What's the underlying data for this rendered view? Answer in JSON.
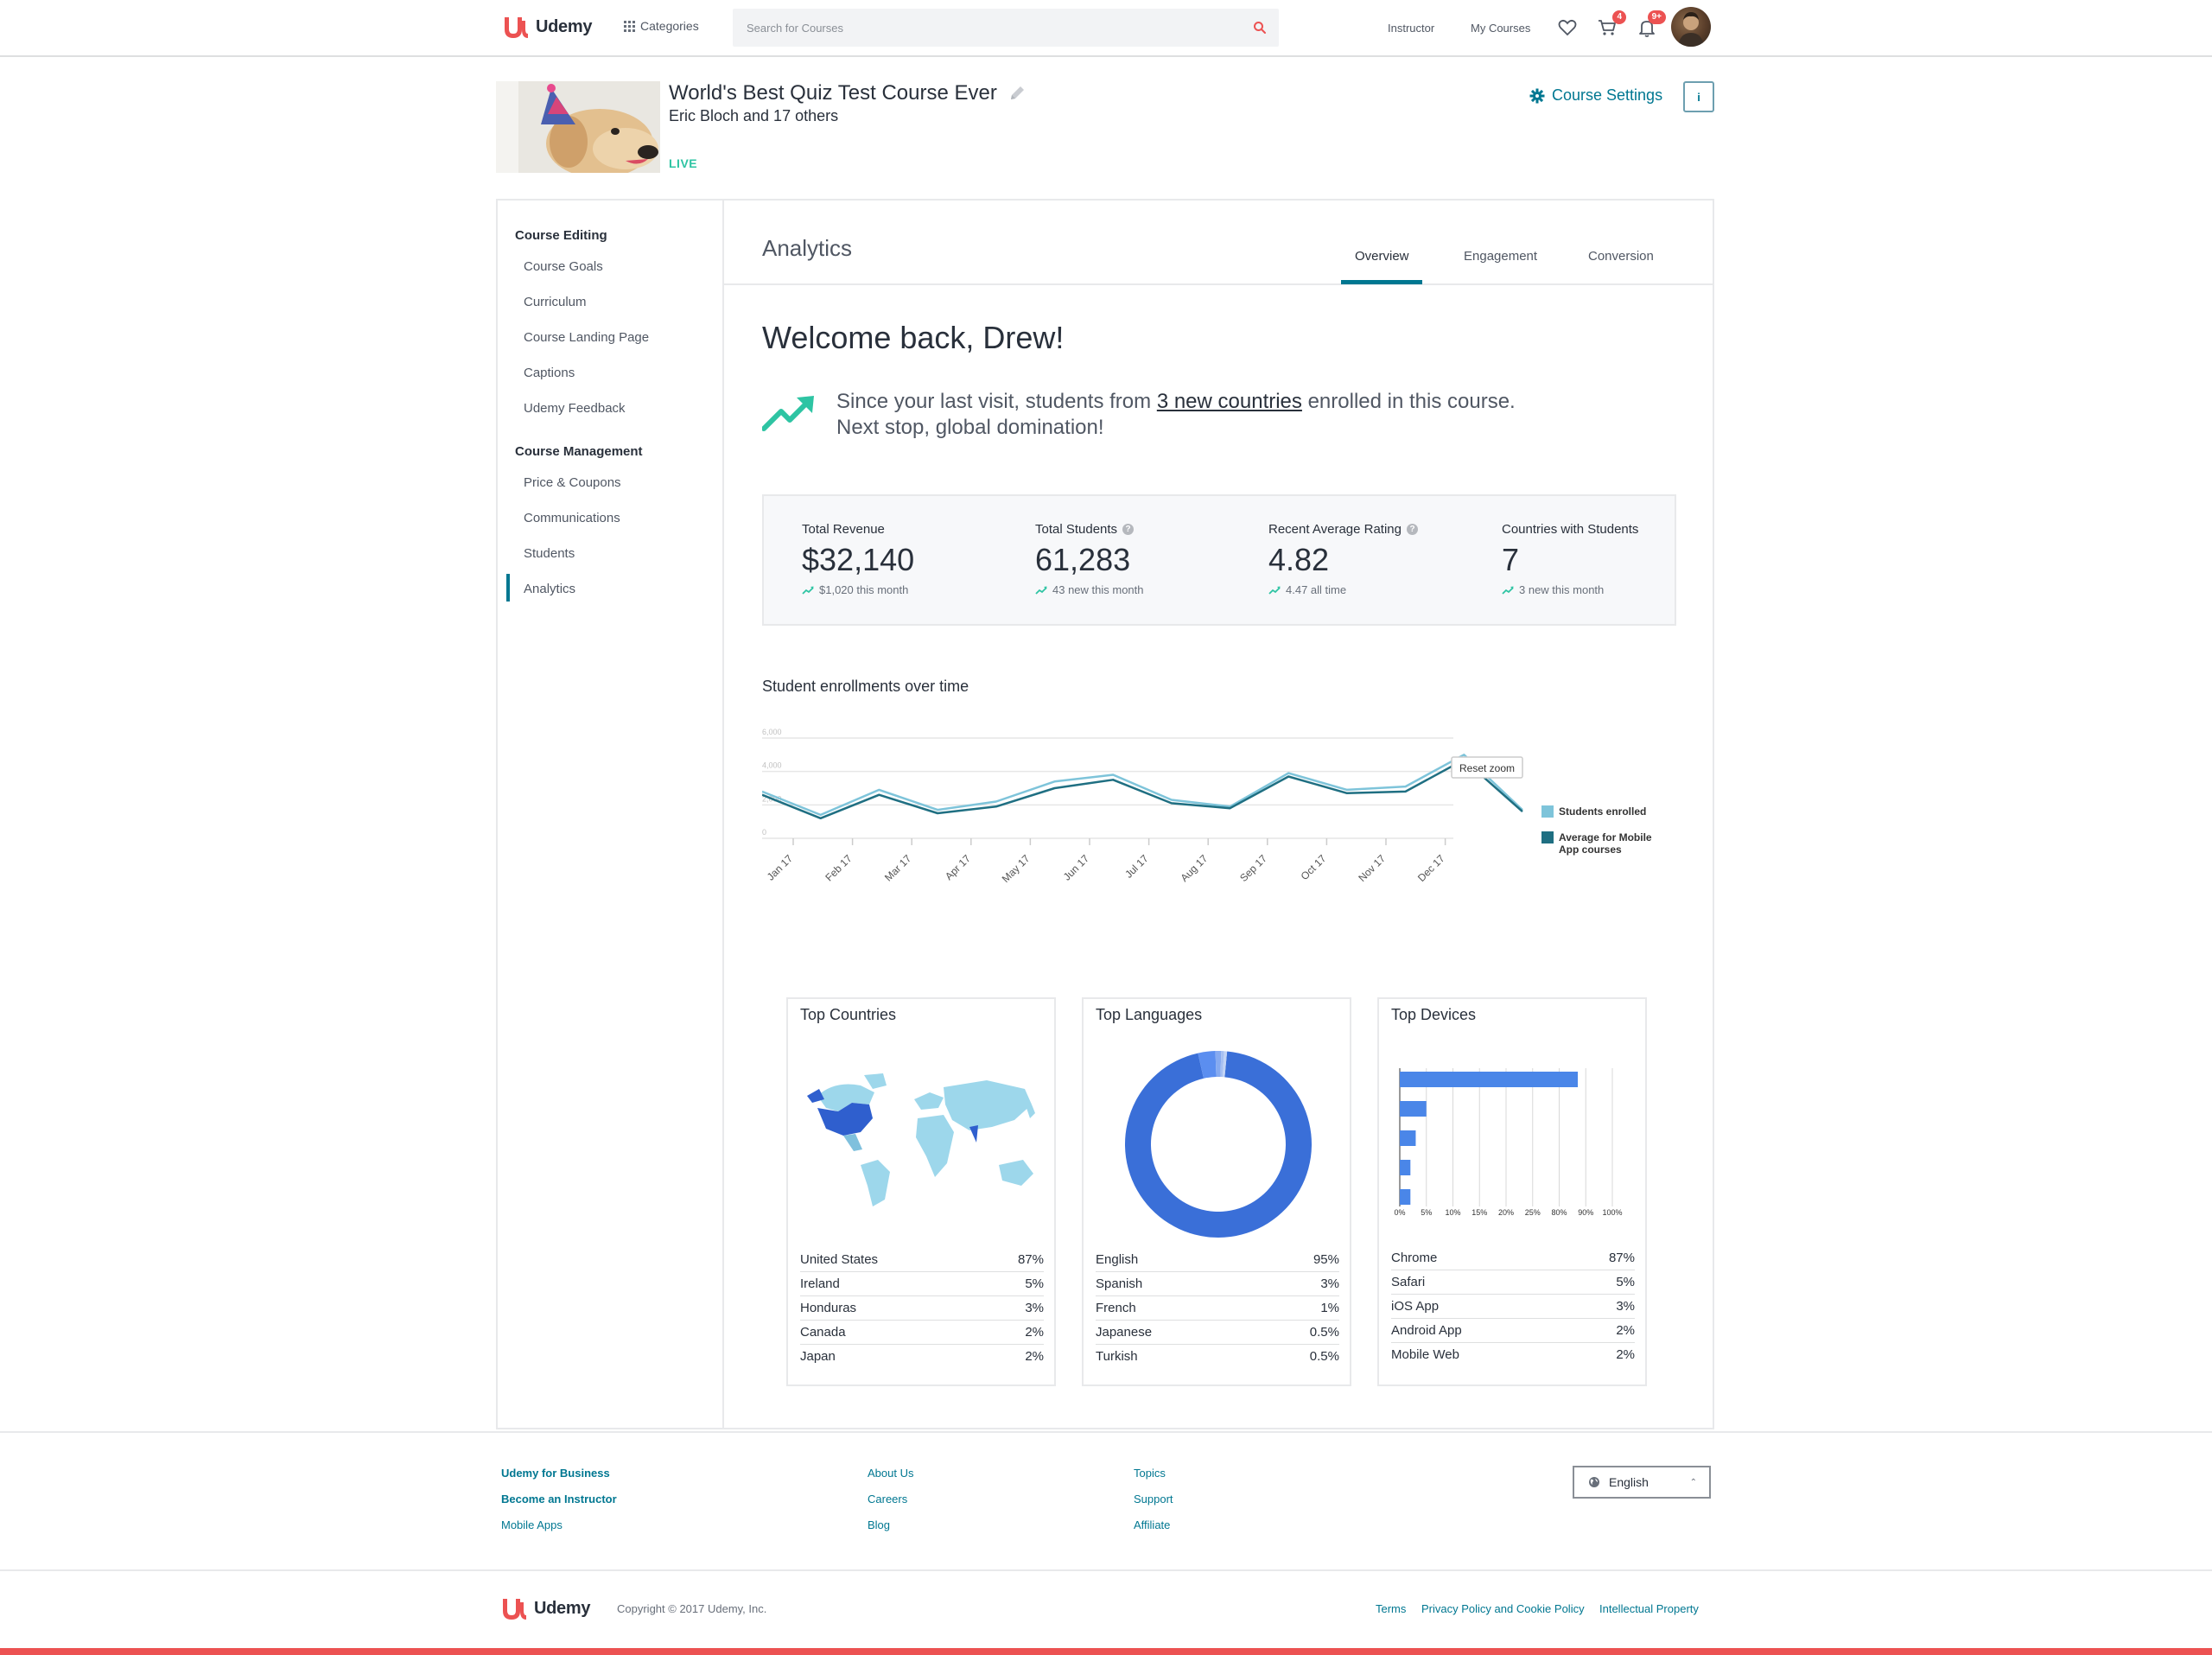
{
  "header": {
    "logo_text": "Udemy",
    "categories_label": "Categories",
    "search_placeholder": "Search for Courses",
    "instructor_label": "Instructor",
    "my_courses_label": "My Courses",
    "cart_badge": "4",
    "notifications_badge": "9+",
    "accent_color": "#ec5252"
  },
  "course": {
    "title": "World's Best Quiz Test Course Ever",
    "instructors": "Eric Bloch and 17 others",
    "status": "LIVE",
    "settings_label": "Course Settings",
    "info_label": "i"
  },
  "sidebar": {
    "section1_title": "Course Editing",
    "section1_items": [
      "Course Goals",
      "Curriculum",
      "Course Landing Page",
      "Captions",
      "Udemy Feedback"
    ],
    "section2_title": "Course Management",
    "section2_items": [
      "Price & Coupons",
      "Communications",
      "Students",
      "Analytics"
    ],
    "active_item": "Analytics"
  },
  "analytics": {
    "title": "Analytics",
    "tabs": [
      "Overview",
      "Engagement",
      "Conversion"
    ],
    "active_tab": "Overview",
    "welcome": "Welcome back, Drew!",
    "since_pre": "Since your last visit, students from ",
    "since_link": "3 new countries",
    "since_post": " enrolled in this course.",
    "since_line2": "Next stop, global domination!",
    "stats": [
      {
        "label": "Total Revenue",
        "value": "$32,140",
        "sub": "$1,020 this month",
        "help": false
      },
      {
        "label": "Total Students",
        "value": "61,283",
        "sub": "43 new this month",
        "help": true
      },
      {
        "label": "Recent Average Rating",
        "value": "4.82",
        "sub": "4.47 all time",
        "help": true
      },
      {
        "label": "Countries with Students",
        "value": "7",
        "sub": "3 new this month",
        "help": false
      }
    ]
  },
  "chart_data": [
    {
      "type": "line",
      "title": "Student enrollments over time",
      "categories": [
        "Jan 17",
        "Feb 17",
        "Mar 17",
        "Apr 17",
        "May 17",
        "Jun 17",
        "Jul 17",
        "Aug 17",
        "Sep 17",
        "Oct 17",
        "Nov 17",
        "Dec 17"
      ],
      "y_ticks": [
        0,
        2000,
        4000,
        6000
      ],
      "ylim": [
        0,
        6000
      ],
      "reset_zoom_label": "Reset zoom",
      "series": [
        {
          "name": "Students enrolled",
          "color": "#7ec4da",
          "values": [
            2800,
            1400,
            2900,
            1700,
            2200,
            3400,
            3800,
            2300,
            1900,
            3900,
            2900,
            3100,
            5000,
            1700
          ]
        },
        {
          "name": "Average for Mobile App courses",
          "color": "#1f6f82",
          "values": [
            2600,
            1200,
            2600,
            1500,
            1900,
            3000,
            3500,
            2100,
            1800,
            3700,
            2700,
            2800,
            4700,
            1600
          ]
        }
      ],
      "legend": "right"
    },
    {
      "type": "map",
      "title": "Top Countries",
      "rows": [
        {
          "label": "United States",
          "value": "87%"
        },
        {
          "label": "Ireland",
          "value": "5%"
        },
        {
          "label": "Honduras",
          "value": "3%"
        },
        {
          "label": "Canada",
          "value": "2%"
        },
        {
          "label": "Japan",
          "value": "2%"
        }
      ]
    },
    {
      "type": "pie",
      "title": "Top Languages",
      "rows": [
        {
          "label": "English",
          "value": "95%"
        },
        {
          "label": "Spanish",
          "value": "3%"
        },
        {
          "label": "French",
          "value": "1%"
        },
        {
          "label": "Japanese",
          "value": "0.5%"
        },
        {
          "label": "Turkish",
          "value": "0.5%"
        }
      ],
      "slices": [
        {
          "label": "English",
          "value": 95,
          "color": "#3a6fd8"
        },
        {
          "label": "Spanish",
          "value": 3,
          "color": "#5b8ef0"
        },
        {
          "label": "French",
          "value": 1,
          "color": "#86aaf0"
        },
        {
          "label": "Japanese",
          "value": 0.5,
          "color": "#a6c0f2"
        },
        {
          "label": "Turkish",
          "value": 0.5,
          "color": "#c2d4f5"
        }
      ]
    },
    {
      "type": "bar",
      "title": "Top Devices",
      "orientation": "horizontal",
      "x_ticks": [
        "0%",
        "5%",
        "10%",
        "15%",
        "20%",
        "25%",
        "80%",
        "90%",
        "100%"
      ],
      "values": [
        87,
        5,
        3,
        2,
        2
      ],
      "bar_color": "#4a86e8",
      "rows": [
        {
          "label": "Chrome",
          "value": "87%"
        },
        {
          "label": "Safari",
          "value": "5%"
        },
        {
          "label": "iOS App",
          "value": "3%"
        },
        {
          "label": "Android App",
          "value": "2%"
        },
        {
          "label": "Mobile Web",
          "value": "2%"
        }
      ]
    }
  ],
  "footer": {
    "col1": [
      "Udemy for Business",
      "Become an Instructor",
      "Mobile Apps"
    ],
    "col2": [
      "About Us",
      "Careers",
      "Blog"
    ],
    "col3": [
      "Topics",
      "Support",
      "Affiliate"
    ],
    "language": "English",
    "logo_text": "Udemy",
    "copyright": "Copyright © 2017 Udemy, Inc.",
    "legal": [
      "Terms",
      "Privacy Policy and Cookie Policy",
      "Intellectual Property"
    ]
  }
}
